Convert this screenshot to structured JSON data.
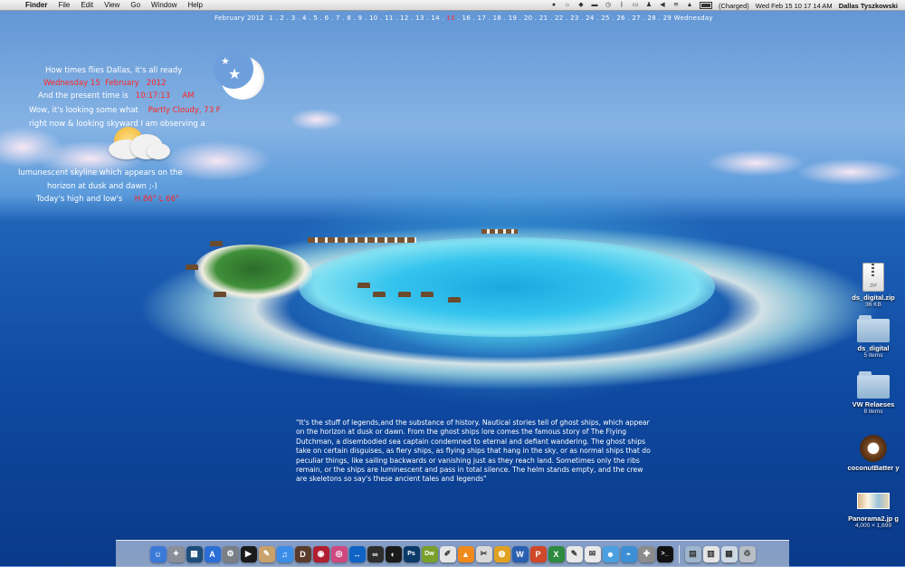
{
  "menubar": {
    "app_name": "Finder",
    "menus": [
      "File",
      "Edit",
      "View",
      "Go",
      "Window",
      "Help"
    ],
    "battery_status": "(Charged)",
    "clock": "Wed Feb 15  10 17 14 AM",
    "user": "Dallas Tyszkowski"
  },
  "calendar": {
    "month_label": "February 2012",
    "days_before": "1 . 2 . 3 . 4 . 5 . 6 . 7 . 8 . 9 . 10 . 11 . 12 . 13 . 14 .",
    "today": "15",
    "days_after": ". 16 . 17 . 18 . 19 . 20 . 21 . 22 . 23 . 24 . 25 . 26 . 27 . 28 . 29",
    "weekday": "Wednesday"
  },
  "weather": {
    "greeting": "How times flies Dallas, it's all ready",
    "date_day": "Wednesday 15",
    "date_month": "February",
    "date_year": "2012",
    "time_prefix": "And the present time is",
    "time_value": "10:17:13",
    "time_ampm": "AM",
    "condition_prefix": "Wow, it's looking some  what",
    "condition_value": "Partly Cloudy, 73 F",
    "line_right_now": "right now & looking skyward I am observing a",
    "line_lumi": "lumunescent skyline which appears on the",
    "line_horizon": "horizon at dusk and dawn ;-)",
    "hilo_prefix": "Today's high and low's",
    "hilo_value": "H 86°  L 66°"
  },
  "quote": "\"It's the stuff of legends,and the substance of history. Nautical stories tell of ghost ships, which appear on the horizon at dusk or dawn. From the ghost ships lore comes the famous story of The Flying Dutchman, a disembodied sea captain condemned to eternal and defiant wandering. The ghost ships take on certain disguises, as fiery ships, as flying ships that hang in the sky, or as normal ships that do peculiar things, like sailing backwards or vanishing just as they reach land. Sometimes only the ribs remain, or the ships are luminescent and pass in total silence. The helm stands empty, and the crew are skeletons so say's these ancient tales and legends\"",
  "desktop_icons": [
    {
      "name": "ds_digital.zip",
      "sub": "36 KB",
      "icon": "zip-archive-icon"
    },
    {
      "name": "ds_digital",
      "sub": "5 items",
      "icon": "folder-icon"
    },
    {
      "name": "VW Relaeses",
      "sub": "8 items",
      "icon": "folder-icon"
    },
    {
      "name": "coconutBatter y",
      "sub": "",
      "icon": "coconut-icon"
    },
    {
      "name": "Panorama2.jp g",
      "sub": "4,000 × 1,699",
      "icon": "image-thumbnail-icon"
    }
  ],
  "dock_items": [
    {
      "name": "finder",
      "color": "#3a79d8",
      "glyph": "☺"
    },
    {
      "name": "launchpad",
      "color": "#8a8f99",
      "glyph": "✦"
    },
    {
      "name": "mission-control",
      "color": "#1f4d7a",
      "glyph": "▦"
    },
    {
      "name": "app-store",
      "color": "#2b6fd6",
      "glyph": "A"
    },
    {
      "name": "system-preferences",
      "color": "#7a7f86",
      "glyph": "⚙"
    },
    {
      "name": "quicktime",
      "color": "#1a1a1a",
      "glyph": "▶"
    },
    {
      "name": "preview",
      "color": "#c9a16a",
      "glyph": "✎"
    },
    {
      "name": "itunes",
      "color": "#3b8ee8",
      "glyph": "♫"
    },
    {
      "name": "dictionary",
      "color": "#5b3b2b",
      "glyph": "D"
    },
    {
      "name": "photo-booth",
      "color": "#b02030",
      "glyph": "◉"
    },
    {
      "name": "dashboard",
      "color": "#d04880",
      "glyph": "◎"
    },
    {
      "name": "teamviewer",
      "color": "#0e63c4",
      "glyph": "↔"
    },
    {
      "name": "remote",
      "color": "#2e2e2e",
      "glyph": "∞"
    },
    {
      "name": "cyberduck",
      "color": "#1a1a1a",
      "glyph": "◐"
    },
    {
      "name": "photoshop",
      "color": "#0c3a68",
      "glyph": "Ps"
    },
    {
      "name": "dreamweaver",
      "color": "#7aa02c",
      "glyph": "Dw"
    },
    {
      "name": "textedit",
      "color": "#e6e6e6",
      "glyph": "✐"
    },
    {
      "name": "vlc",
      "color": "#f08a1c",
      "glyph": "▲"
    },
    {
      "name": "script-editor",
      "color": "#d8d8d8",
      "glyph": "✂"
    },
    {
      "name": "chrome",
      "color": "#e0a220",
      "glyph": "◍"
    },
    {
      "name": "word",
      "color": "#2a5fb0",
      "glyph": "W"
    },
    {
      "name": "powerpoint",
      "color": "#d0482a",
      "glyph": "P"
    },
    {
      "name": "excel",
      "color": "#2e8a3e",
      "glyph": "X"
    },
    {
      "name": "pages",
      "color": "#e8e8e8",
      "glyph": "✎"
    },
    {
      "name": "keynote",
      "color": "#eaeaea",
      "glyph": "✉"
    },
    {
      "name": "ichat",
      "color": "#4aa0e0",
      "glyph": "☻"
    },
    {
      "name": "network-utility",
      "color": "#3c8fd4",
      "glyph": "◓"
    },
    {
      "name": "disk-utility",
      "color": "#8c8c8c",
      "glyph": "✚"
    },
    {
      "name": "terminal",
      "color": "#111111",
      "glyph": ">_"
    },
    {
      "name": "applications-stack",
      "color": "#9fb6cc",
      "glyph": "▤"
    },
    {
      "name": "documents-stack",
      "color": "#e5e5e5",
      "glyph": "▥"
    },
    {
      "name": "downloads-stack",
      "color": "#cfd9e4",
      "glyph": "▦"
    },
    {
      "name": "trash",
      "color": "#b9bec6",
      "glyph": "♲"
    }
  ]
}
